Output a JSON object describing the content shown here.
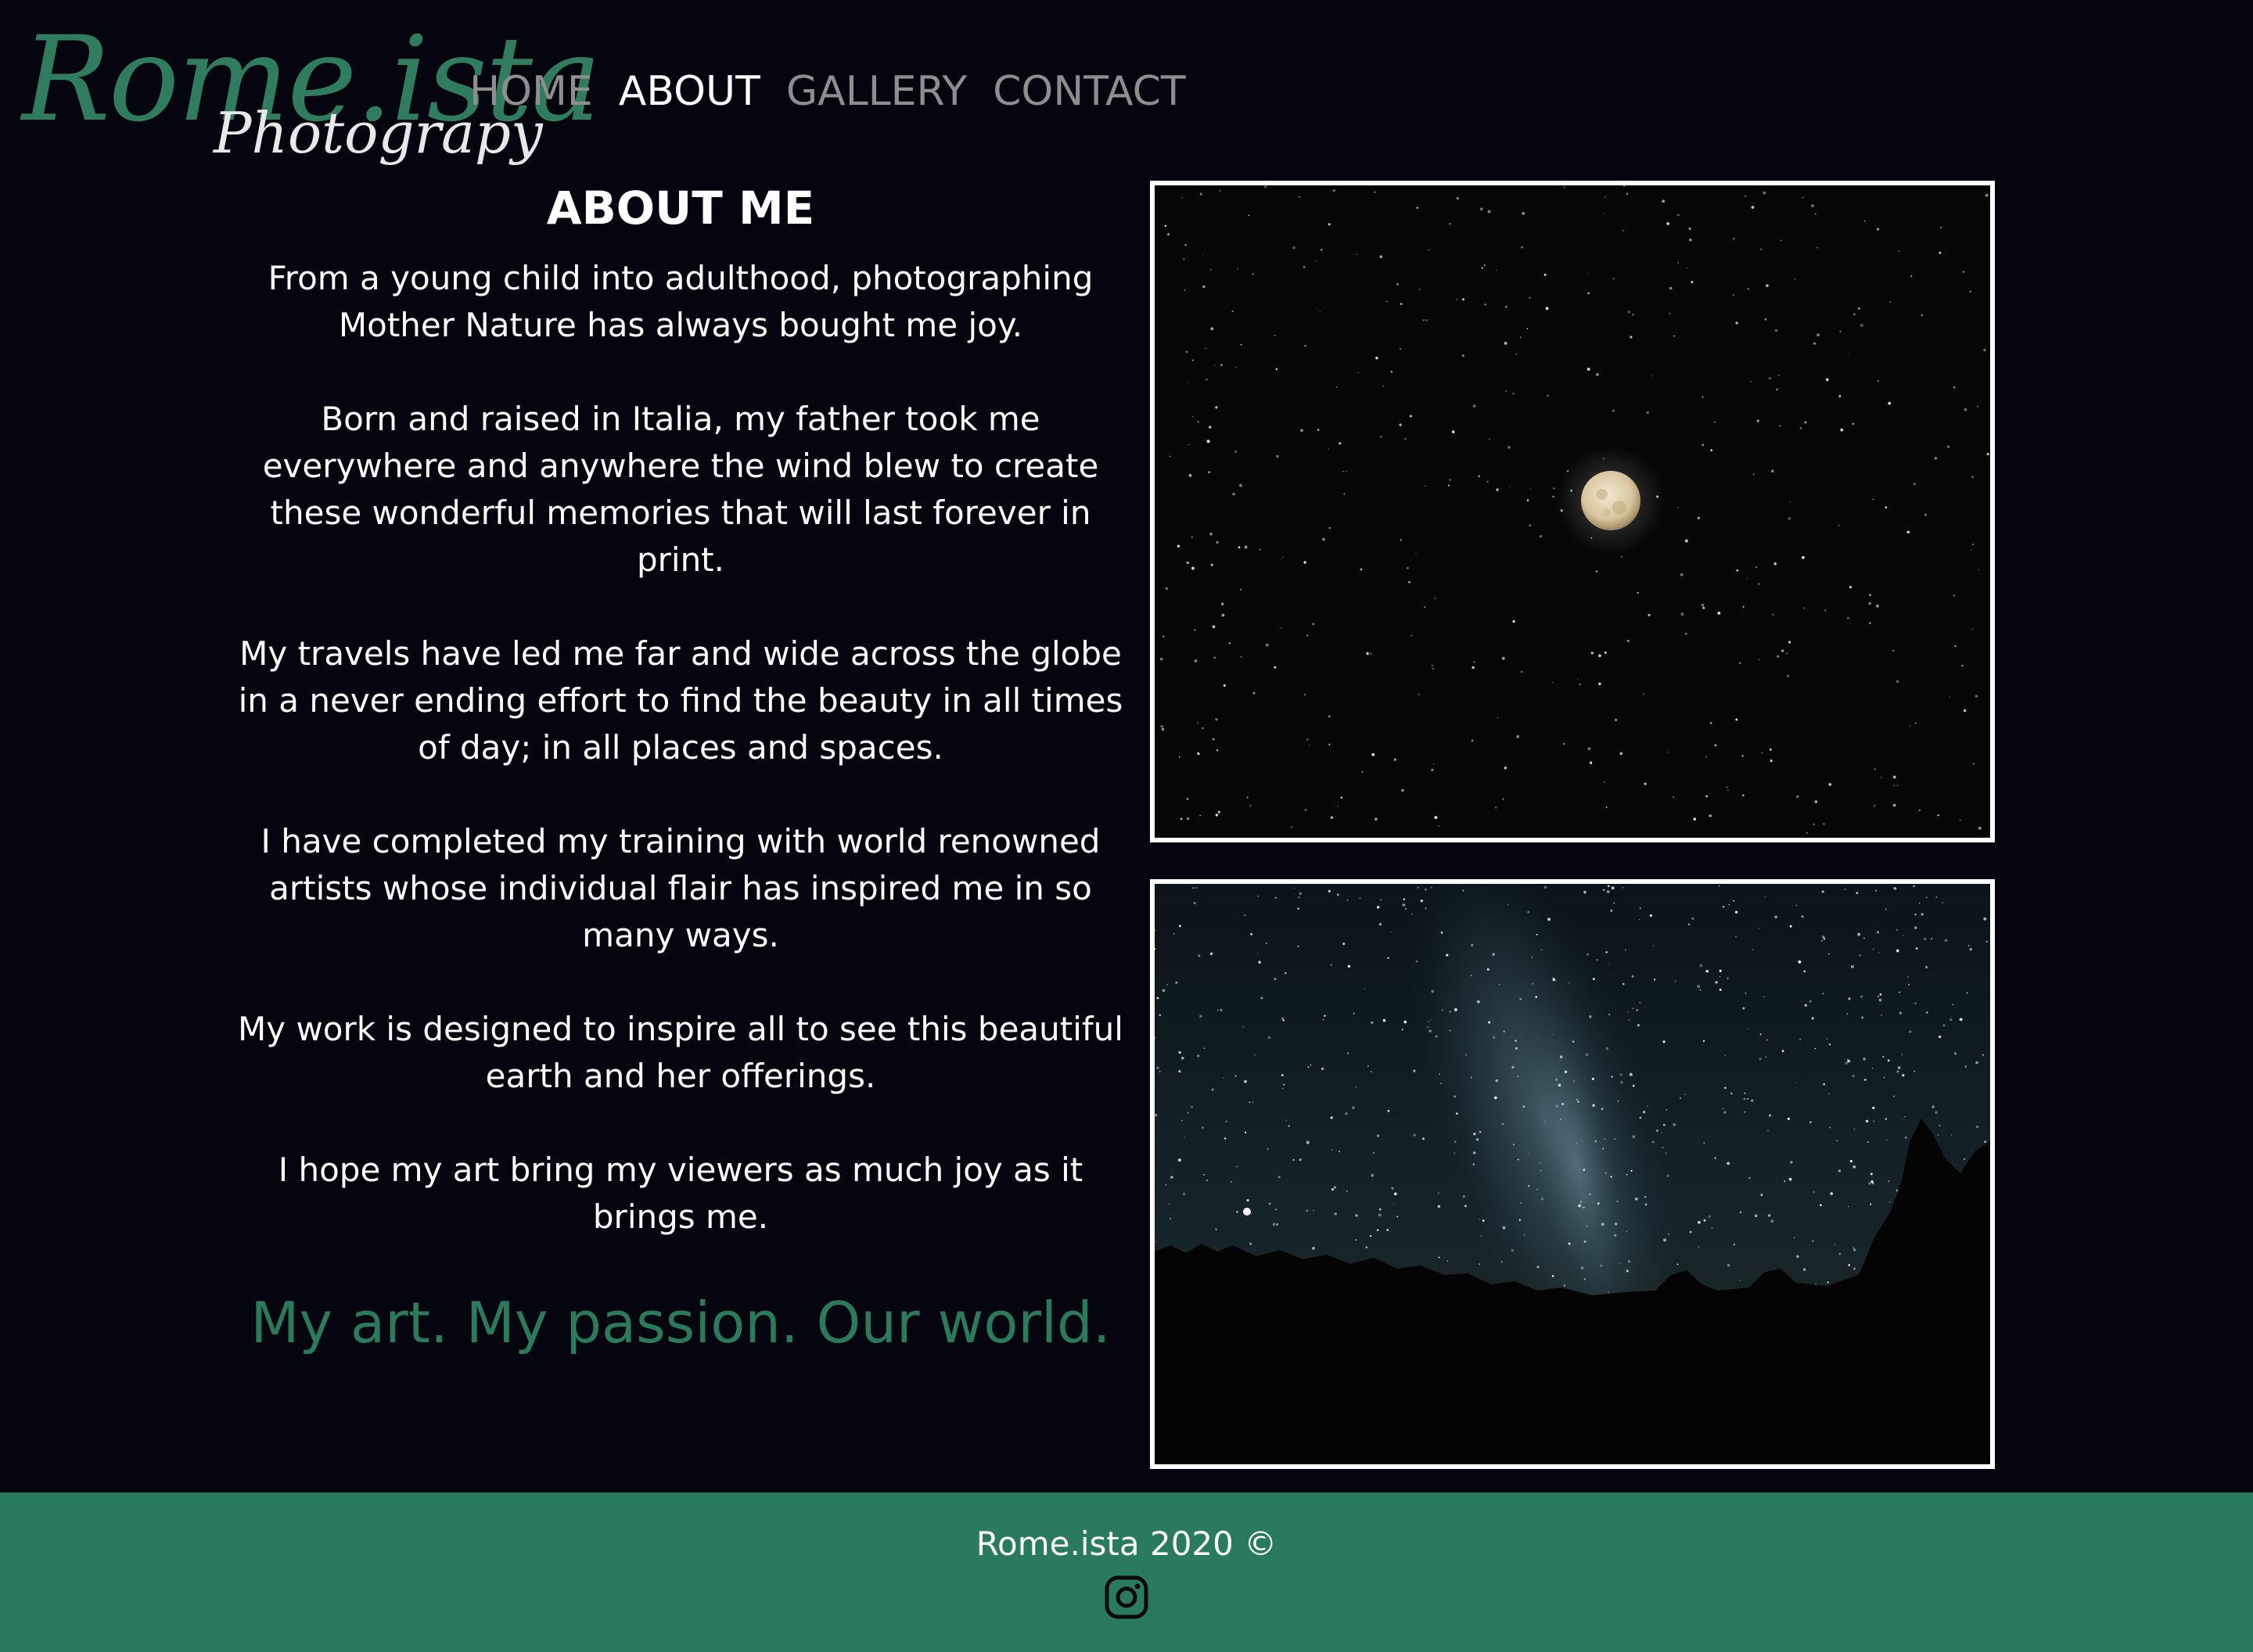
{
  "brand": {
    "logo_main": "Rome.ista",
    "logo_sub": "Photograpy"
  },
  "nav": {
    "items": [
      {
        "label": "HOME",
        "active": false
      },
      {
        "label": "ABOUT",
        "active": true
      },
      {
        "label": "GALLERY",
        "active": false
      },
      {
        "label": "CONTACT",
        "active": false
      }
    ]
  },
  "about": {
    "title": "ABOUT ME",
    "paragraphs": [
      "From a young child into adulthood, photographing Mother Nature has always bought me joy.",
      "Born and raised in Italia, my father took me everywhere and anywhere the wind blew to create these wonderful memories that will last forever in print.",
      "My travels have led me far and wide across the globe in a never ending effort to find the beauty in all times of day; in all places and spaces.",
      "I have completed my training with world renowned artists whose individual flair has inspired me in so many ways.",
      "My work is designed to inspire all to see this beautiful earth and her offerings.",
      "I hope my art bring my viewers as much joy as it brings me."
    ],
    "tagline": "My art. My passion. Our world."
  },
  "footer": {
    "copyright": "Rome.ista 2020 ©",
    "social_icon": "instagram-icon"
  },
  "colors": {
    "background": "#050510",
    "accent": "#2a7a5f",
    "nav_inactive": "#8e8e8e",
    "nav_active": "#ffffff"
  }
}
